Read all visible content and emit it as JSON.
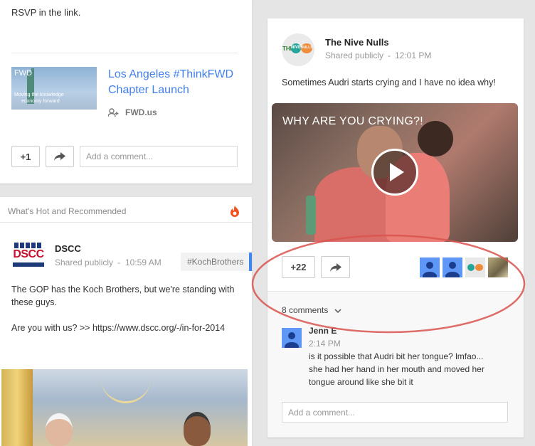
{
  "left_top_post": {
    "rsvp_text": "RSVP in the link.",
    "link_title_line1": "Los Angeles #ThinkFWD",
    "link_title_line2": "Chapter Launch",
    "link_source": "FWD.us",
    "thumb_logo": "FWD",
    "thumb_caption_line1": "Moving the knowledge",
    "thumb_caption_line2": "economy forward",
    "plus_one_label": "+1",
    "comment_placeholder": "Add a comment..."
  },
  "recommended": {
    "section_title": "What's Hot and Recommended",
    "author": "DSCC",
    "shared": "Shared publicly",
    "time": "10:59 AM",
    "hashtag": "#KochBrothers",
    "body_line1": "The GOP has the Koch Brothers, but we're standing with",
    "body_line2": "these guys.",
    "body_line3": "Are you with us? >> https://www.dscc.org/-/in-for-2014",
    "logo_text": "DSCC"
  },
  "nive_post": {
    "author": "The Nive Nulls",
    "shared": "Shared publicly",
    "time": "12:01 PM",
    "body": "Sometimes Audri starts crying and I have no idea why!",
    "video_title": "WHY ARE YOU CRYING?!",
    "plus_count": "+22",
    "comments_count": "8 comments",
    "comment_author": "Jenn E",
    "comment_time": "2:14 PM",
    "comment_line1": "is it possible that Audri bit her tongue? lmfao...",
    "comment_line2": "she had her hand in her mouth and moved her",
    "comment_line3": "tongue around like she bit it",
    "comment_placeholder": "Add a comment...",
    "logo_text_the": "THE",
    "logo_text_nive": "NIVE",
    "logo_text_nulls": "NULLS"
  },
  "colors": {
    "link_blue": "#427fed",
    "annotation_red": "#d9534f",
    "hot_orange": "#f4511e"
  }
}
